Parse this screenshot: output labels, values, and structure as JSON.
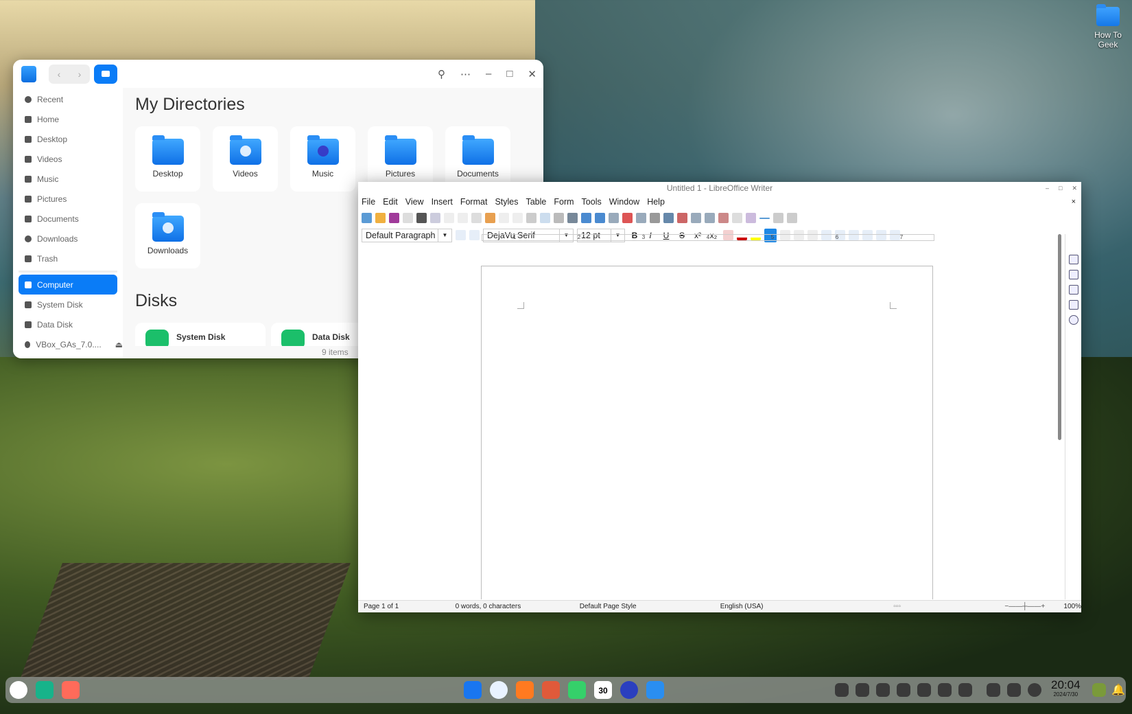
{
  "desktop": {
    "icons": [
      {
        "label": "How To Geek"
      }
    ]
  },
  "file_manager": {
    "sidebar": [
      {
        "label": "Recent",
        "icon": "clock-icon"
      },
      {
        "label": "Home",
        "icon": "home-icon"
      },
      {
        "label": "Desktop",
        "icon": "desktop-icon"
      },
      {
        "label": "Videos",
        "icon": "film-icon"
      },
      {
        "label": "Music",
        "icon": "music-icon"
      },
      {
        "label": "Pictures",
        "icon": "image-icon"
      },
      {
        "label": "Documents",
        "icon": "document-icon"
      },
      {
        "label": "Downloads",
        "icon": "download-icon"
      },
      {
        "label": "Trash",
        "icon": "trash-icon"
      },
      {
        "label": "Computer",
        "icon": "computer-icon",
        "active": true
      },
      {
        "label": "System Disk",
        "icon": "disk-icon"
      },
      {
        "label": "Data Disk",
        "icon": "disk-icon"
      },
      {
        "label": "VBox_GAs_7.0....",
        "icon": "cdrom-icon"
      }
    ],
    "eject": "⏏",
    "heading_dirs": "My Directories",
    "dirs": [
      "Desktop",
      "Videos",
      "Music",
      "Pictures",
      "Documents",
      "Downloads"
    ],
    "heading_disks": "Disks",
    "disks": [
      "System Disk",
      "Data Disk"
    ],
    "status": "9 items"
  },
  "writer": {
    "title": "Untitled 1 - LibreOffice Writer",
    "menu": [
      "File",
      "Edit",
      "View",
      "Insert",
      "Format",
      "Styles",
      "Table",
      "Form",
      "Tools",
      "Window",
      "Help"
    ],
    "close_doc": "×",
    "paragraph_style": "Default Paragraph",
    "font_name": "DejaVu Serif",
    "font_size": "12 pt",
    "fmt": {
      "bold": "B",
      "italic": "I",
      "underline": "U",
      "strike": "S",
      "super": "x²",
      "sub": "x₂"
    },
    "ruler": [
      "1",
      "2",
      "3",
      "4",
      "5",
      "6",
      "7"
    ],
    "status": {
      "page": "Page 1 of 1",
      "words": "0 words, 0 characters",
      "page_style": "Default Page Style",
      "language": "English (USA)",
      "zoom": "100%"
    }
  },
  "taskbar": {
    "time": "20:04",
    "date": "2024/7/30",
    "calendar_day": "30"
  },
  "colors": {
    "accent": "#0a7cf7"
  }
}
